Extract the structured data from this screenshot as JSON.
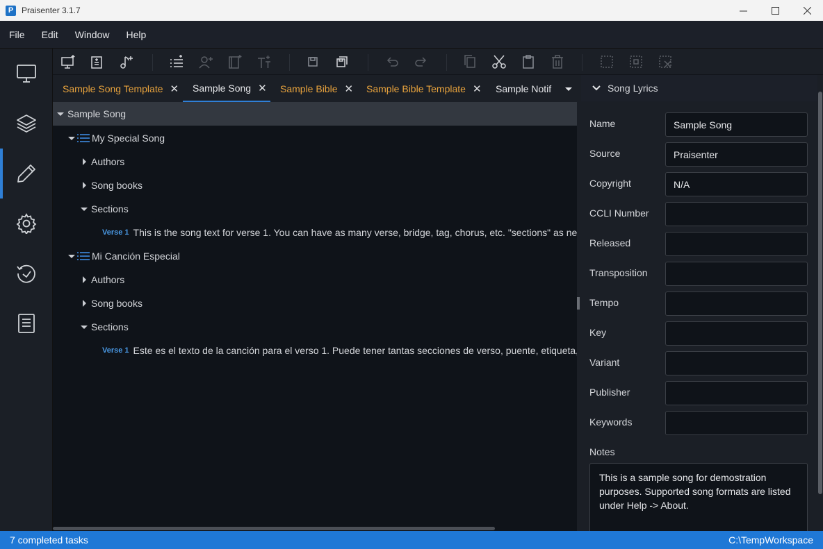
{
  "window": {
    "title": "Praisenter 3.1.7",
    "logo_letter": "P"
  },
  "menu": [
    "File",
    "Edit",
    "Window",
    "Help"
  ],
  "rail": {
    "items": [
      "present-icon",
      "layers-icon",
      "edit-icon",
      "settings-icon",
      "history-icon",
      "document-icon"
    ],
    "active_index": 2
  },
  "toolbar": {
    "buttons": [
      "new-slide-icon",
      "new-document-icon",
      "new-song-icon",
      "add-section-icon",
      "add-author-icon",
      "add-songbook-icon",
      "add-text-icon",
      "save-icon",
      "save-all-icon",
      "undo-icon",
      "redo-icon",
      "copy-icon",
      "cut-icon",
      "paste-icon",
      "delete-icon",
      "select-all-icon",
      "select-icon",
      "deselect-icon"
    ]
  },
  "tabs": [
    {
      "label": "Sample Song Template",
      "color": "#e8a33d",
      "closable": true
    },
    {
      "label": "Sample Song",
      "color": "#e6e7ea",
      "closable": true,
      "active": true
    },
    {
      "label": "Sample Bible",
      "color": "#e8a33d",
      "closable": true
    },
    {
      "label": "Sample Bible Template",
      "color": "#e8a33d",
      "closable": true
    },
    {
      "label": "Sample Notif",
      "color": "#e6e7ea",
      "closable": false
    }
  ],
  "tree": {
    "root": "Sample Song",
    "lyrics": [
      {
        "title": "My Special Song",
        "authors": "Authors",
        "songbooks": "Song books",
        "sections": "Sections",
        "verse_tag": "Verse 1",
        "verse_text": "This is the song text for verse 1.  You can have as many verse, bridge, tag, chorus, etc. \"sections\" as needed."
      },
      {
        "title": "Mi Canción Especial",
        "authors": "Authors",
        "songbooks": "Song books",
        "sections": "Sections",
        "verse_tag": "Verse 1",
        "verse_text": "Este es el texto de la canción para el verso 1. Puede tener tantas secciones de verso, puente, etiqueta, coro, etc."
      }
    ]
  },
  "props": {
    "header": "Song Lyrics",
    "fields": [
      {
        "label": "Name",
        "value": "Sample Song"
      },
      {
        "label": "Source",
        "value": "Praisenter"
      },
      {
        "label": "Copyright",
        "value": "N/A"
      },
      {
        "label": "CCLI Number",
        "value": ""
      },
      {
        "label": "Released",
        "value": ""
      },
      {
        "label": "Transposition",
        "value": ""
      },
      {
        "label": "Tempo",
        "value": ""
      },
      {
        "label": "Key",
        "value": ""
      },
      {
        "label": "Variant",
        "value": ""
      },
      {
        "label": "Publisher",
        "value": ""
      },
      {
        "label": "Keywords",
        "value": ""
      }
    ],
    "notes_label": "Notes",
    "notes": "This is a sample song for demostration purposes.  Supported song formats are listed under Help -> About."
  },
  "status": {
    "left": "7 completed tasks",
    "right": "C:\\TempWorkspace"
  },
  "colors": {
    "accent": "#2f7fd6",
    "template_tab": "#e8a33d",
    "verse_tag": "#4a9ae6"
  }
}
